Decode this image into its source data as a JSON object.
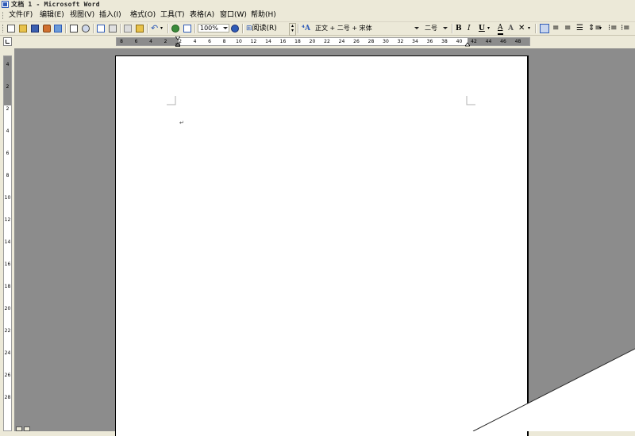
{
  "window": {
    "title": "文档 1 - Microsoft Word"
  },
  "menubar": {
    "items": [
      {
        "label": "文件(F)"
      },
      {
        "label": "编辑(E)"
      },
      {
        "label": "视图(V)"
      },
      {
        "label": "插入(I)"
      },
      {
        "label": "格式(O)"
      },
      {
        "label": "工具(T)"
      },
      {
        "label": "表格(A)"
      },
      {
        "label": "窗口(W)"
      },
      {
        "label": "帮助(H)"
      }
    ]
  },
  "toolbar": {
    "zoom": "100%",
    "read_label": "阅读(R)",
    "style": "正文 + 二号 + 宋体",
    "font_size": "二号",
    "bold": "B",
    "italic": "I",
    "underline": "U",
    "font_color": "A",
    "char_scale": "A"
  },
  "ruler": {
    "horizontal_labels": [
      "8",
      "6",
      "4",
      "2",
      "2",
      "4",
      "6",
      "8",
      "10",
      "12",
      "14",
      "16",
      "18",
      "20",
      "22",
      "24",
      "26",
      "28",
      "30",
      "32",
      "34",
      "36",
      "38",
      "40",
      "42",
      "44",
      "46",
      "48"
    ],
    "vertical_labels": [
      "4",
      "2",
      "2",
      "4",
      "6",
      "8",
      "10",
      "12",
      "14",
      "16",
      "18",
      "20",
      "22",
      "24",
      "26",
      "28"
    ]
  },
  "colors": {
    "chrome": "#ece9d8",
    "workspace": "#8c8c8c",
    "page": "#ffffff",
    "accent": "#2f5bb7"
  }
}
